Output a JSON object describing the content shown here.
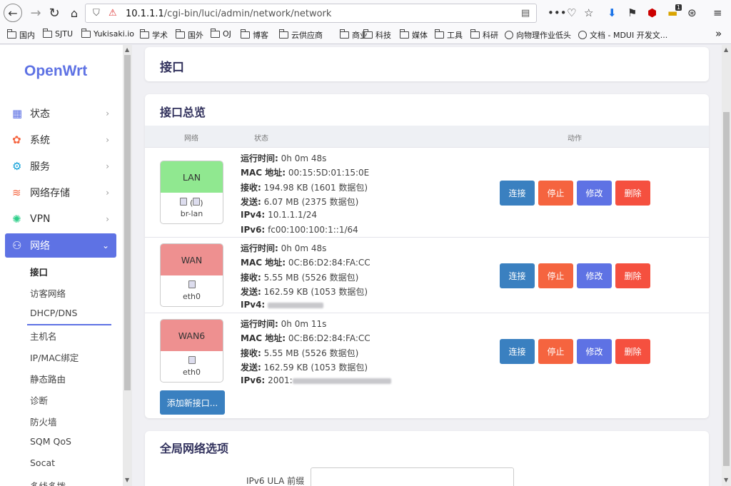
{
  "browser": {
    "url_prefix": "10.1.1.1",
    "url_rest": "/cgi-bin/luci/admin/network/network",
    "extension_badge": "1",
    "bookmarks": [
      "国内",
      "SJTU",
      "Yukisaki.io",
      "学术",
      "国外",
      "OJ",
      "博客",
      "云供应商",
      "商业",
      "科技",
      "媒体",
      "工具",
      "科研"
    ],
    "bookmark_sites": [
      "向物理作业低头",
      "文档 - MDUI 开发文..."
    ]
  },
  "sidebar": {
    "logo": "OpenWrt",
    "items": [
      {
        "label": "状态",
        "icon": "dashboard-icon"
      },
      {
        "label": "系统",
        "icon": "gear-icon"
      },
      {
        "label": "服务",
        "icon": "services-icon"
      },
      {
        "label": "网络存储",
        "icon": "database-icon"
      },
      {
        "label": "VPN",
        "icon": "vpn-icon"
      },
      {
        "label": "网络",
        "icon": "network-icon"
      }
    ],
    "subitems": [
      "接口",
      "访客网络",
      "DHCP/DNS",
      "主机名",
      "IP/MAC绑定",
      "静态路由",
      "诊断",
      "防火墙",
      "SQM QoS",
      "Socat",
      "多线多拨"
    ]
  },
  "page": {
    "title": "接口",
    "overview_title": "接口总览",
    "columns": {
      "network": "网络",
      "status": "状态",
      "actions": "动作"
    },
    "labels": {
      "uptime": "运行时间:",
      "mac": "MAC 地址:",
      "rx": "接收:",
      "tx": "发送:",
      "ipv4": "IPv4:",
      "ipv6": "IPv6:"
    },
    "interfaces": [
      {
        "name": "LAN",
        "color": "#90e890",
        "device": "br-lan",
        "uptime": "0h 0m 48s",
        "mac": "00:15:5D:01:15:0E",
        "rx": "194.98 KB (1601 数据包)",
        "tx": "6.07 MB (2375 数据包)",
        "ipv4": "10.1.1.1/24",
        "ipv6": "fc00:100:100:1::1/64"
      },
      {
        "name": "WAN",
        "color": "#ee9090",
        "device": "eth0",
        "uptime": "0h 0m 48s",
        "mac": "0C:B6:D2:84:FA:CC",
        "rx": "5.55 MB (5526 数据包)",
        "tx": "162.59 KB (1053 数据包)"
      },
      {
        "name": "WAN6",
        "color": "#ee9090",
        "device": "eth0",
        "uptime": "0h 0m 11s",
        "mac": "0C:B6:D2:84:FA:CC",
        "rx": "5.55 MB (5526 数据包)",
        "tx": "162.59 KB (1053 数据包)",
        "ipv6_prefix": "2001:"
      }
    ],
    "actions": {
      "connect": "连接",
      "stop": "停止",
      "edit": "修改",
      "delete": "删除"
    },
    "add_button": "添加新接口...",
    "global_title": "全局网络选项",
    "ula_label": "IPv6 ULA 前缀"
  }
}
